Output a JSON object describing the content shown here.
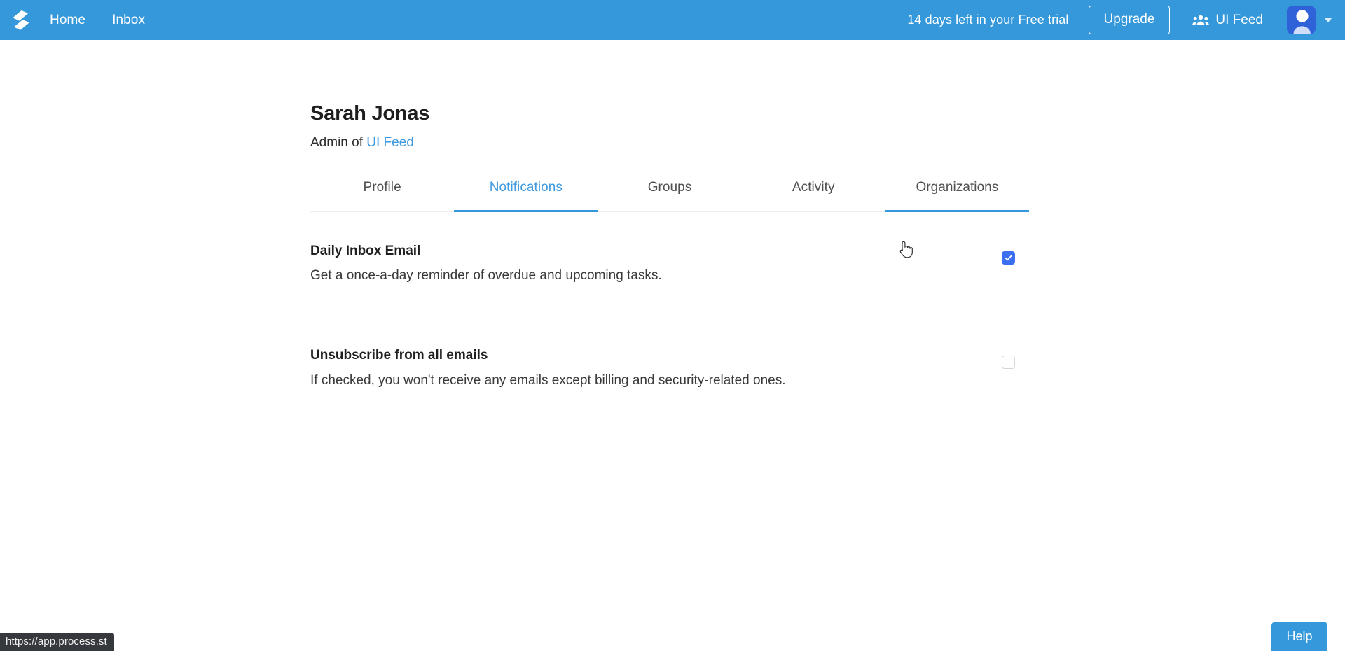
{
  "header": {
    "logo_icon": "process-street-logo-icon",
    "nav": [
      {
        "label": "Home"
      },
      {
        "label": "Inbox"
      }
    ],
    "trial_notice": "14 days left in your Free trial",
    "upgrade_label": "Upgrade",
    "organization": {
      "icon": "people-group-icon",
      "label": "UI Feed"
    },
    "avatar_icon": "user-avatar-icon",
    "caret_icon": "chevron-down-icon",
    "background_color": "#3498db",
    "avatar_color": "#2f62d8"
  },
  "profile": {
    "name": "Sarah Jonas",
    "role_prefix": "Admin of ",
    "organization_link": "UI Feed",
    "link_color": "#3d9ae0"
  },
  "tabs": {
    "items": [
      {
        "label": "Profile",
        "state": "default"
      },
      {
        "label": "Notifications",
        "state": "active"
      },
      {
        "label": "Groups",
        "state": "default"
      },
      {
        "label": "Activity",
        "state": "default"
      },
      {
        "label": "Organizations",
        "state": "hovered"
      }
    ],
    "active_color": "#3498db"
  },
  "notifications": {
    "rows": [
      {
        "title": "Daily Inbox Email",
        "description": "Get a once-a-day reminder of overdue and upcoming tasks.",
        "checked": true
      },
      {
        "title": "Unsubscribe from all emails",
        "description": "If checked, you won't receive any emails except billing and security-related ones.",
        "checked": false
      }
    ],
    "checked_color": "#3b6ef0"
  },
  "help": {
    "label": "Help"
  },
  "status_bar": {
    "url": "https://app.process.st"
  }
}
